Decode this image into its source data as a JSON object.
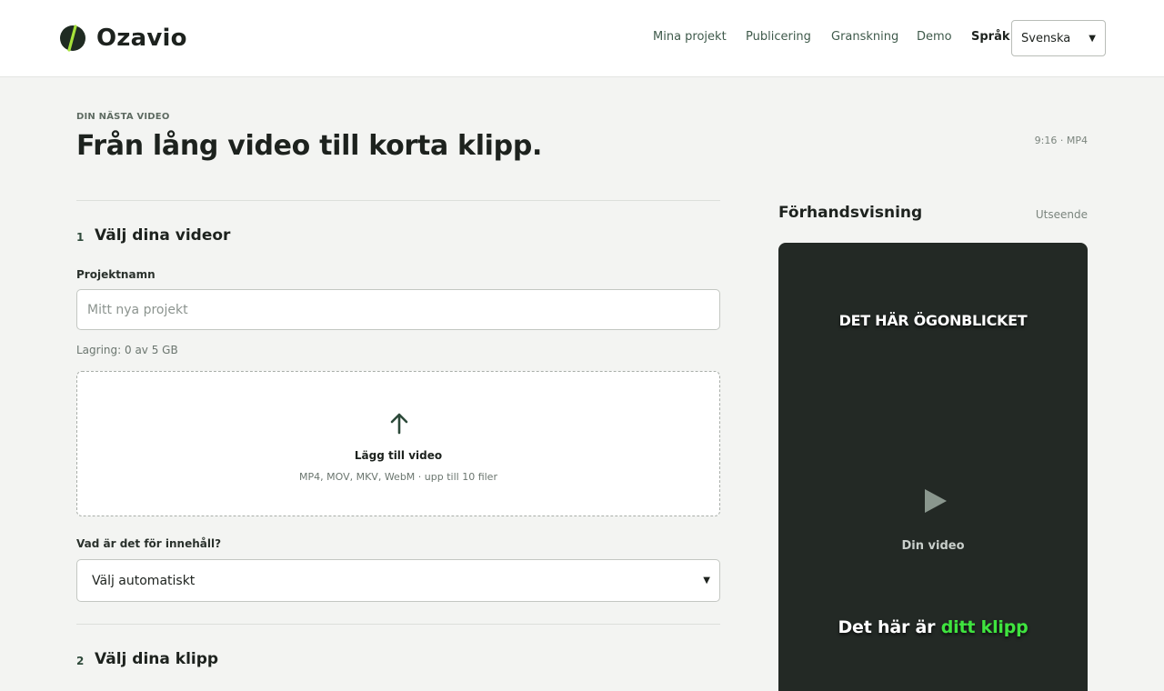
{
  "app": {
    "name": "Ozavio",
    "brand_color": "#a6e23a",
    "accent_color": "#3fe43f"
  },
  "nav": {
    "items": [
      {
        "label": "Mina projekt"
      },
      {
        "label": "Publicering"
      },
      {
        "label": "Granskning"
      },
      {
        "label": "Demo"
      }
    ],
    "language_label": "Språk",
    "language_value": "Svenska"
  },
  "page": {
    "eyebrow": "DIN NÄSTA VIDEO",
    "title": "Från lång video till korta klipp.",
    "format_meta": "9:16 · MP4"
  },
  "step1": {
    "number": "1",
    "title": "Välj dina videor",
    "project_label": "Projektnamn",
    "project_placeholder": "Mitt nya projekt",
    "storage": "Lagring: 0 av 5 GB",
    "upload": {
      "icon": "arrow-up-icon",
      "title": "Lägg till video",
      "subtitle": "MP4, MOV, MKV, WebM · upp till 10 filer"
    },
    "content_label": "Vad är det för innehåll?",
    "content_value": "Välj automatiskt"
  },
  "step2": {
    "number": "2",
    "title": "Välj dina klipp"
  },
  "preview": {
    "title": "Förhandsvisning",
    "appearance_link": "Utseende",
    "caption_top": "DET HÄR ÖGONBLICKET",
    "play_icon": "play-icon",
    "video_label": "Din video",
    "caption_bottom_prefix": "Det här är",
    "caption_bottom_accent": "ditt klipp"
  }
}
